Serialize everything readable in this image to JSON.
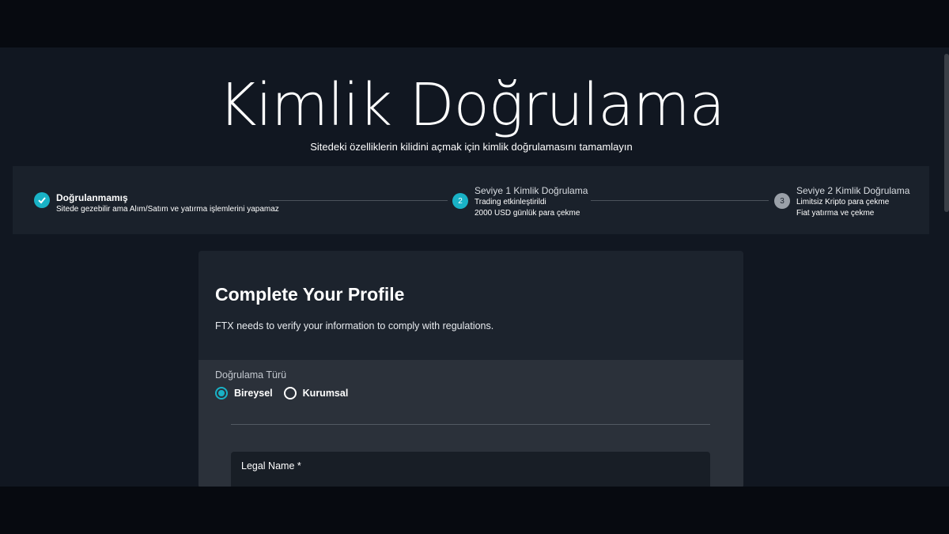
{
  "hero": {
    "title": "Kimlik Doğrulama",
    "subtitle": "Sitedeki özelliklerin kilidini açmak için kimlik doğrulamasını tamamlayın"
  },
  "stepper": {
    "steps": [
      {
        "marker": "",
        "icon": "check-icon",
        "status": "completed",
        "title": "Doğrulanmamış",
        "lines": [
          "Sitede gezebilir ama Alım/Satım ve yatırma işlemlerini yapamaz"
        ]
      },
      {
        "marker": "2",
        "status": "active",
        "title": "Seviye 1 Kimlik Doğrulama",
        "lines": [
          "Trading etkinleştirildi",
          "2000 USD günlük para çekme"
        ]
      },
      {
        "marker": "3",
        "status": "pending",
        "title": "Seviye 2 Kimlik Doğrulama",
        "lines": [
          "Limitsiz Kripto para çekme",
          "Fiat yatırma ve çekme"
        ]
      }
    ]
  },
  "profile": {
    "title": "Complete Your Profile",
    "description": "FTX needs to verify your information to comply with regulations.",
    "verification_type": {
      "label": "Doğrulama Türü",
      "options": [
        {
          "label": "Bireysel",
          "checked": true
        },
        {
          "label": "Kurumsal",
          "checked": false
        }
      ]
    },
    "legal_name": {
      "label": "Legal Name *"
    }
  },
  "colors": {
    "accent": "#19b2c6",
    "background": "#111721",
    "panel": "#1a212b"
  }
}
